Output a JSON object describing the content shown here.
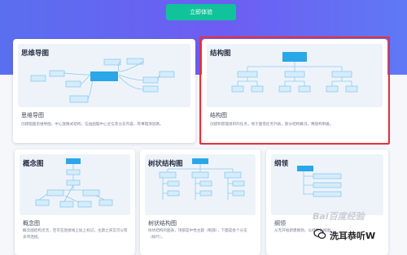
{
  "banner": {
    "cta_label": "立即体验",
    "accent": "#10c39a",
    "bg": "#6467f1"
  },
  "cards": {
    "mindmap": {
      "title": "思维导图",
      "name": "思维导图",
      "desc": "创建脑图思维导图。中心放散式结构，信由画脑中心主信及分支内容，有事理清思路。"
    },
    "org": {
      "title": "结构图",
      "name": "结构图",
      "desc": "创建和管理组织的任务，易于图借任务列表。部分结构概况，释放构制备。"
    },
    "concept": {
      "title": "概念图",
      "name": "概念图",
      "desc": "概念图结构灵活，空可在连接线上加上标记，主题之间又可以有多项连接。"
    },
    "tree": {
      "title": "树状结构图",
      "name": "树状结构图",
      "desc": "树状结构的图表，顶部是中性主题（根部），下面是各个分支（枝叶）。"
    },
    "outline": {
      "title": "纲领",
      "name": "纲领",
      "desc": "从无开始新建纲领，以结构化视图..."
    }
  },
  "highlight_color": "#e5303c",
  "watermark": {
    "site": "Bai百度经验",
    "account": "洗耳恭听W"
  }
}
